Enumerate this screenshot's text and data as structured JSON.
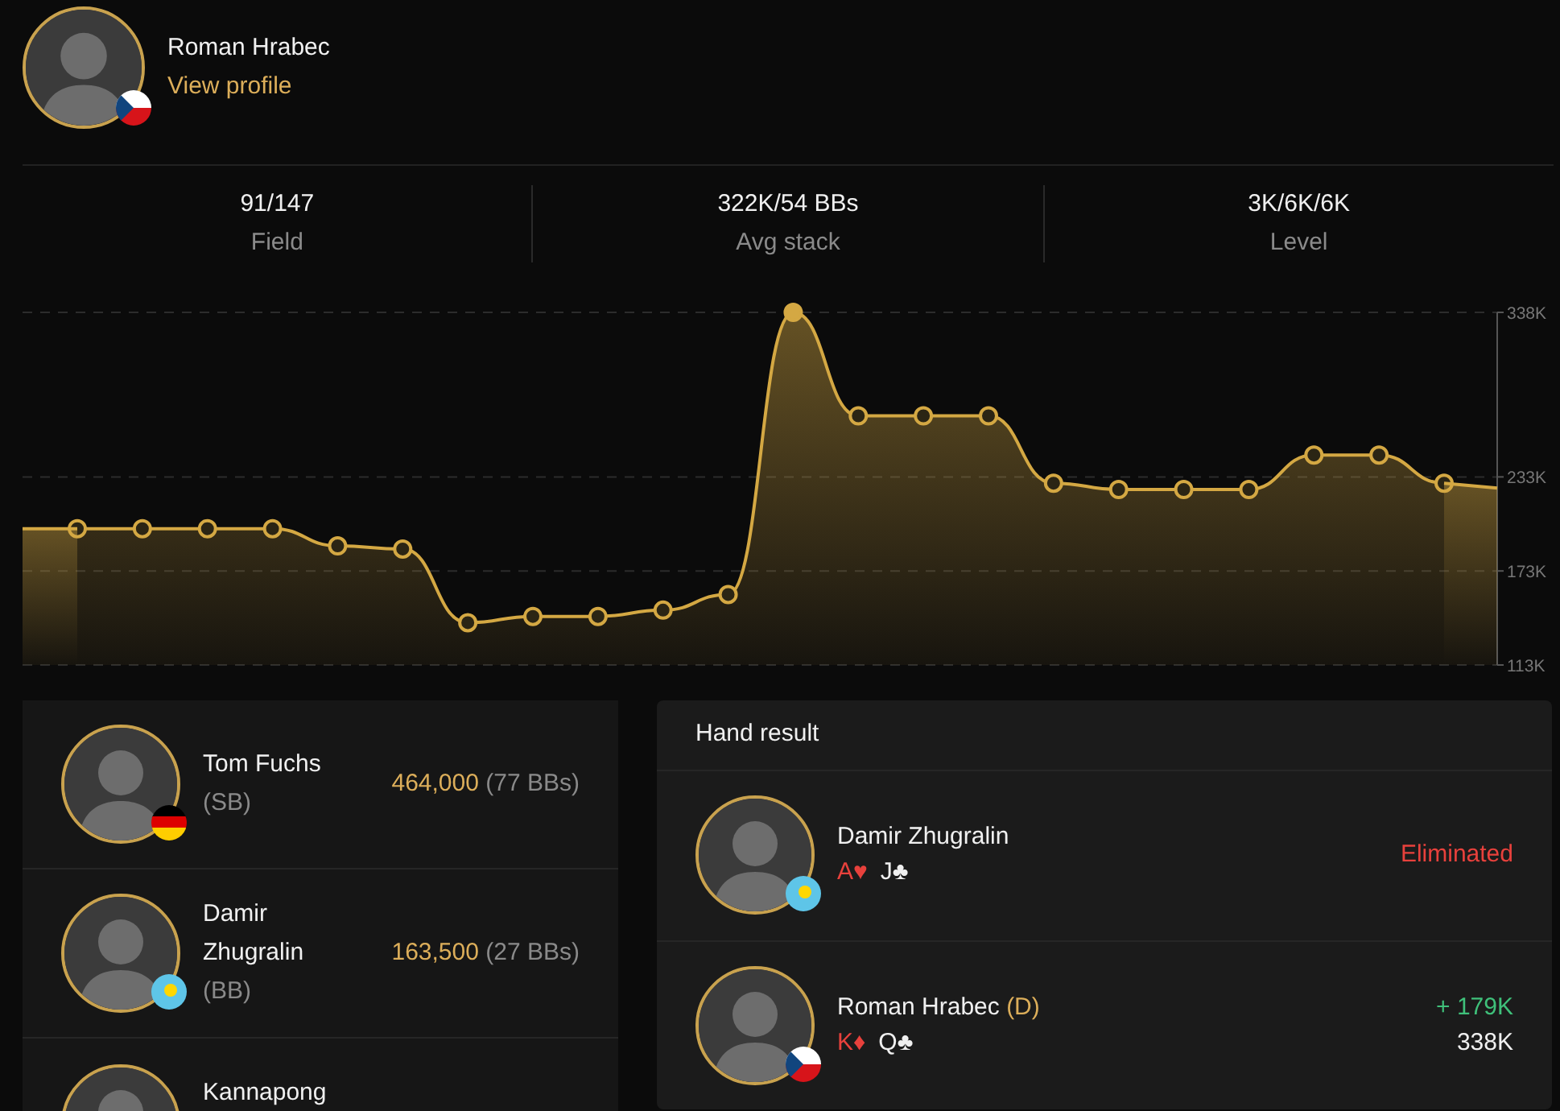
{
  "profile": {
    "name": "Roman Hrabec",
    "link": "View profile",
    "flag": {
      "kind": "cz"
    }
  },
  "stats": [
    {
      "value": "91/147",
      "label": "Field"
    },
    {
      "value": "322K/54 BBs",
      "label": "Avg stack"
    },
    {
      "value": "3K/6K/6K",
      "label": "Level"
    }
  ],
  "chart": {
    "chart_data": {
      "type": "area",
      "values": [
        200000,
        200000,
        200000,
        200000,
        189000,
        187000,
        140000,
        144000,
        144000,
        148000,
        158000,
        338000,
        272000,
        272000,
        272000,
        229000,
        225000,
        225000,
        225000,
        247000,
        247000,
        229000
      ],
      "ylim": [
        113000,
        338000
      ],
      "yticks": [
        {
          "value": 113000,
          "label": "113K"
        },
        {
          "value": 173000,
          "label": "173K"
        },
        {
          "value": 233000,
          "label": "233K"
        },
        {
          "value": 338000,
          "label": "338K"
        }
      ]
    }
  },
  "players": [
    {
      "name": "Tom Fuchs",
      "position": "(SB)",
      "stack": "464,000",
      "bbs": "(77 BBs)",
      "flag": {
        "kind": "de"
      }
    },
    {
      "name": "Damir Zhugralin",
      "position": "(BB)",
      "stack": "163,500",
      "bbs": "(27 BBs)",
      "flag": {
        "kind": "kz"
      }
    },
    {
      "name": "Kannapong"
    }
  ],
  "hand_result": {
    "title": "Hand result",
    "rows": [
      {
        "name": "Damir Zhugralin",
        "flag": {
          "kind": "kz"
        },
        "cards": [
          {
            "rank": "A",
            "suit": "♥",
            "color": "#e8413c"
          },
          {
            "rank": "J",
            "suit": "♣",
            "color": "#f0f0f0"
          }
        ],
        "result": {
          "kind": "eliminated",
          "text": "Eliminated"
        }
      },
      {
        "name": "Roman Hrabec",
        "position": "(D)",
        "flag": {
          "kind": "cz"
        },
        "cards": [
          {
            "rank": "K",
            "suit": "♦",
            "color": "#e8413c"
          },
          {
            "rank": "Q",
            "suit": "♣",
            "color": "#f0f0f0"
          }
        ],
        "result": {
          "kind": "won",
          "change": "+ 179K",
          "stack": "338K"
        }
      }
    ]
  }
}
